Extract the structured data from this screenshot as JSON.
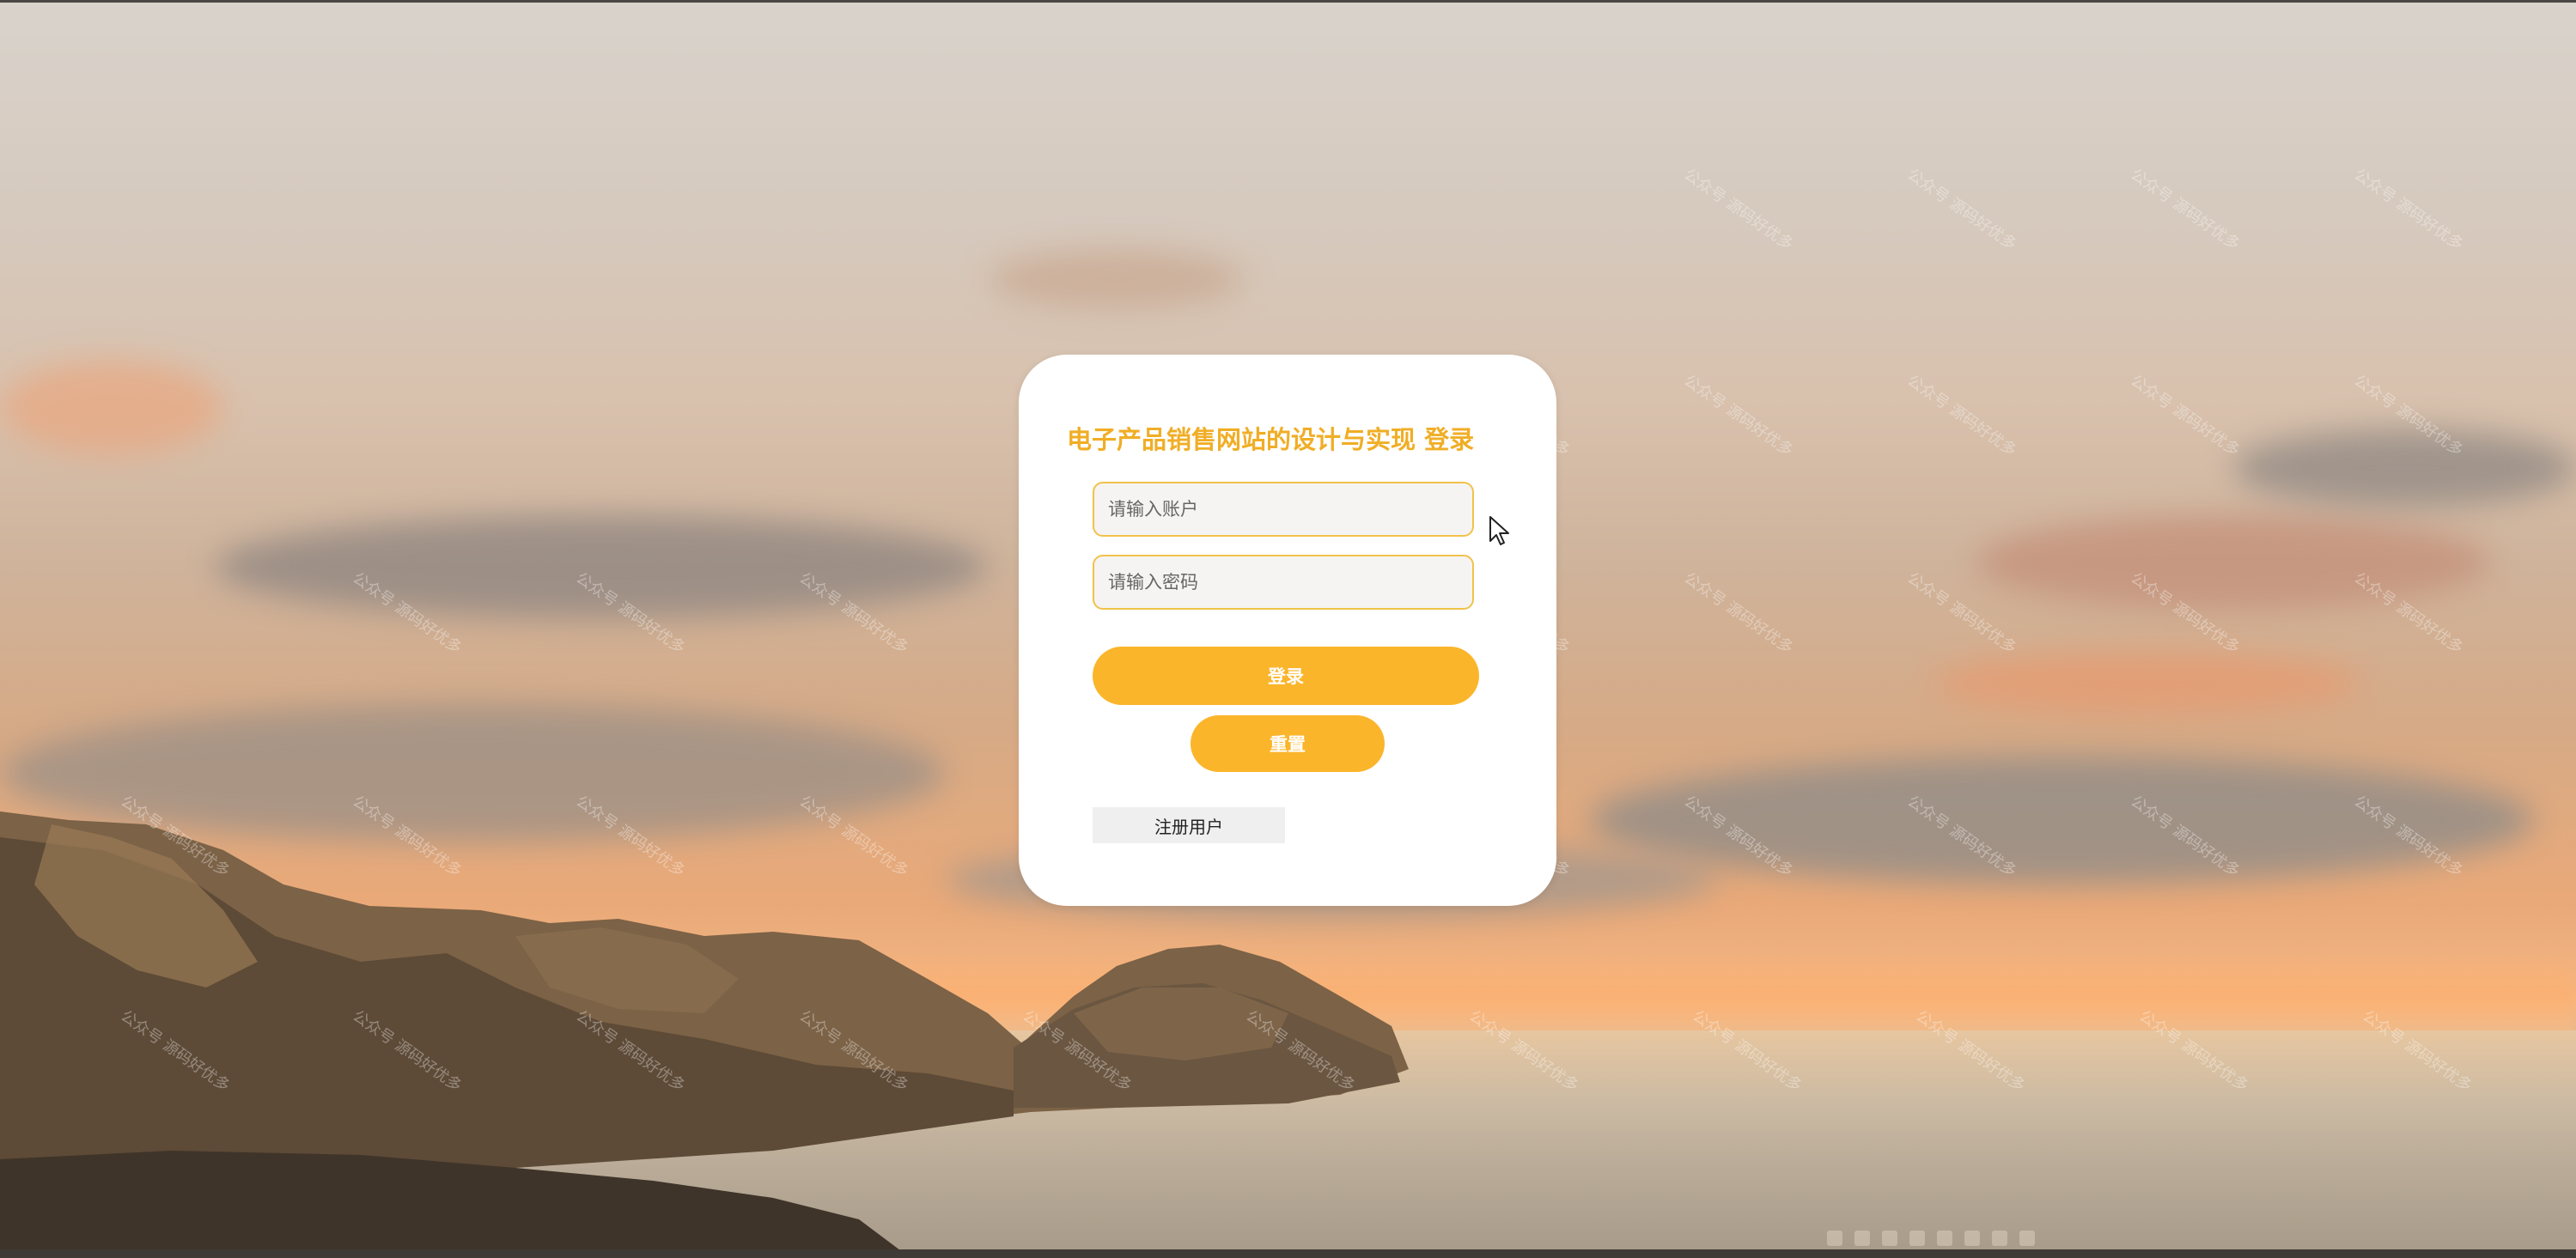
{
  "page": {
    "title": "电子产品销售网站的设计与实现 登录"
  },
  "form": {
    "account_placeholder": "请输入账户",
    "password_placeholder": "请输入密码",
    "login_label": "登录",
    "reset_label": "重置",
    "register_label": "注册用户"
  },
  "watermark": {
    "text": "公众号 源码好优多"
  },
  "colors": {
    "accent": "#fbb52b",
    "title": "#f0ae26",
    "field_border": "#f1c24a",
    "card_bg": "#ffffff"
  },
  "icons": {
    "cursor": "mouse-pointer-icon"
  }
}
